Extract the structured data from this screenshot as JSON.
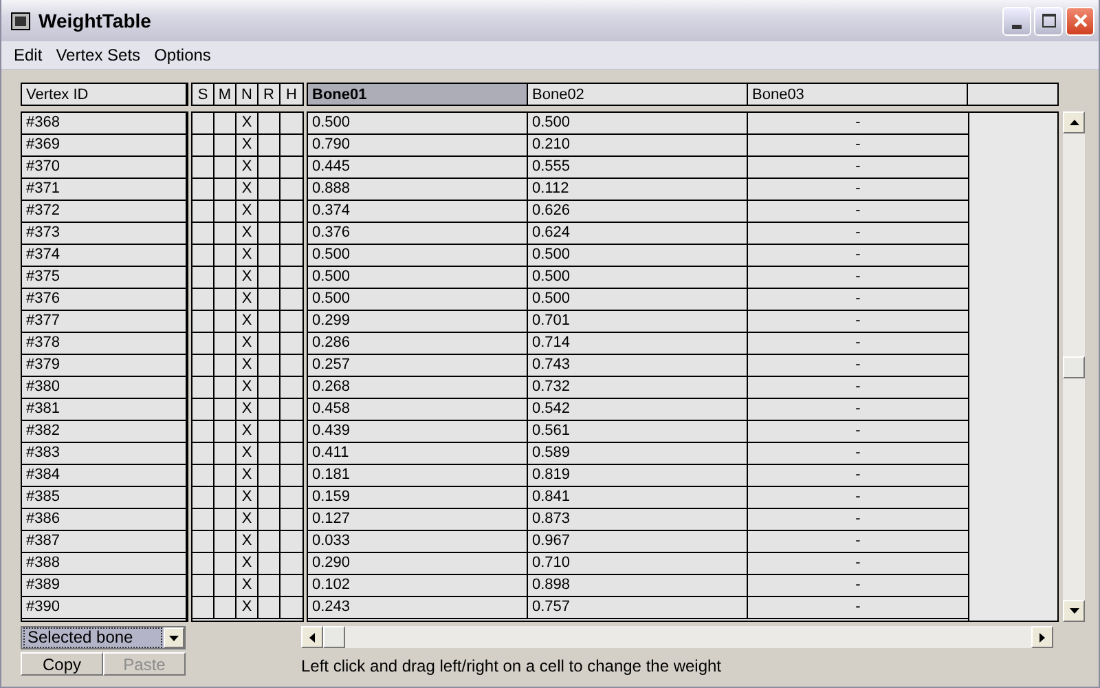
{
  "window": {
    "title": "WeightTable"
  },
  "menu": [
    "Edit",
    "Vertex Sets",
    "Options"
  ],
  "table": {
    "id_column": "Vertex ID",
    "flag_columns": [
      "S",
      "M",
      "N",
      "R",
      "H"
    ],
    "bone_columns": [
      {
        "label": "Bone01",
        "selected": true
      },
      {
        "label": "Bone02",
        "selected": false
      },
      {
        "label": "Bone03",
        "selected": false
      }
    ],
    "rows": [
      {
        "id": "#368",
        "n": "X",
        "weights": [
          "0.500",
          "0.500",
          "-"
        ]
      },
      {
        "id": "#369",
        "n": "X",
        "weights": [
          "0.790",
          "0.210",
          "-"
        ]
      },
      {
        "id": "#370",
        "n": "X",
        "weights": [
          "0.445",
          "0.555",
          "-"
        ]
      },
      {
        "id": "#371",
        "n": "X",
        "weights": [
          "0.888",
          "0.112",
          "-"
        ]
      },
      {
        "id": "#372",
        "n": "X",
        "weights": [
          "0.374",
          "0.626",
          "-"
        ]
      },
      {
        "id": "#373",
        "n": "X",
        "weights": [
          "0.376",
          "0.624",
          "-"
        ]
      },
      {
        "id": "#374",
        "n": "X",
        "weights": [
          "0.500",
          "0.500",
          "-"
        ]
      },
      {
        "id": "#375",
        "n": "X",
        "weights": [
          "0.500",
          "0.500",
          "-"
        ]
      },
      {
        "id": "#376",
        "n": "X",
        "weights": [
          "0.500",
          "0.500",
          "-"
        ]
      },
      {
        "id": "#377",
        "n": "X",
        "weights": [
          "0.299",
          "0.701",
          "-"
        ]
      },
      {
        "id": "#378",
        "n": "X",
        "weights": [
          "0.286",
          "0.714",
          "-"
        ]
      },
      {
        "id": "#379",
        "n": "X",
        "weights": [
          "0.257",
          "0.743",
          "-"
        ]
      },
      {
        "id": "#380",
        "n": "X",
        "weights": [
          "0.268",
          "0.732",
          "-"
        ]
      },
      {
        "id": "#381",
        "n": "X",
        "weights": [
          "0.458",
          "0.542",
          "-"
        ]
      },
      {
        "id": "#382",
        "n": "X",
        "weights": [
          "0.439",
          "0.561",
          "-"
        ]
      },
      {
        "id": "#383",
        "n": "X",
        "weights": [
          "0.411",
          "0.589",
          "-"
        ]
      },
      {
        "id": "#384",
        "n": "X",
        "weights": [
          "0.181",
          "0.819",
          "-"
        ]
      },
      {
        "id": "#385",
        "n": "X",
        "weights": [
          "0.159",
          "0.841",
          "-"
        ]
      },
      {
        "id": "#386",
        "n": "X",
        "weights": [
          "0.127",
          "0.873",
          "-"
        ]
      },
      {
        "id": "#387",
        "n": "X",
        "weights": [
          "0.033",
          "0.967",
          "-"
        ]
      },
      {
        "id": "#388",
        "n": "X",
        "weights": [
          "0.290",
          "0.710",
          "-"
        ]
      },
      {
        "id": "#389",
        "n": "X",
        "weights": [
          "0.102",
          "0.898",
          "-"
        ]
      },
      {
        "id": "#390",
        "n": "X",
        "weights": [
          "0.243",
          "0.757",
          "-"
        ]
      }
    ]
  },
  "bone_dropdown": {
    "value": "Selected bone"
  },
  "buttons": [
    {
      "label": "Copy",
      "disabled": false
    },
    {
      "label": "Paste",
      "disabled": true
    }
  ],
  "hint": "Left click and drag left/right on a cell to change the weight"
}
